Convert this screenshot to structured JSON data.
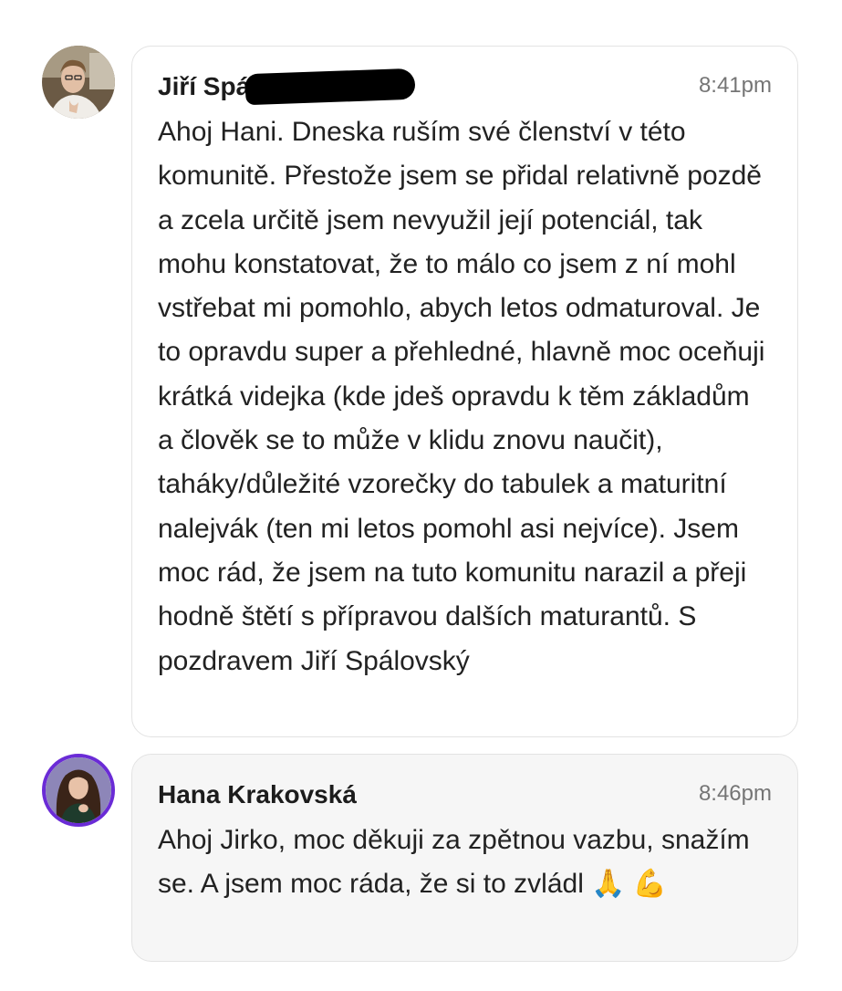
{
  "messages": [
    {
      "author": "Jiří Spálovský",
      "time": "8:41pm",
      "text": "Ahoj Hani. Dneska ruším své členství v této komunitě. Přestože jsem se přidal relativně pozdě a zcela určitě jsem nevyužil její potenciál, tak mohu konstatovat, že to málo co jsem z ní mohl vstřebat mi pomohlo, abych letos odmaturoval. Je to opravdu super a přehledné, hlavně moc oceňuji krátká videjka (kde jdeš opravdu k těm základům a člověk se to může v klidu znovu naučit), taháky/důležité vzorečky do tabulek a maturitní nalejvák (ten mi letos pomohl asi nejvíce). Jsem moc rád, že jsem na tuto komunitu narazil a přeji hodně štětí s přípravou dalších maturantů. S pozdravem Jiří Spálovský"
    },
    {
      "author": "Hana Krakovská",
      "time": "8:46pm",
      "text": "Ahoj Jirko, moc děkuji za zpětnou vazbu, snažím se. A jsem moc ráda, že si to zvládl",
      "emojis": [
        "🙏",
        "💪"
      ]
    }
  ]
}
